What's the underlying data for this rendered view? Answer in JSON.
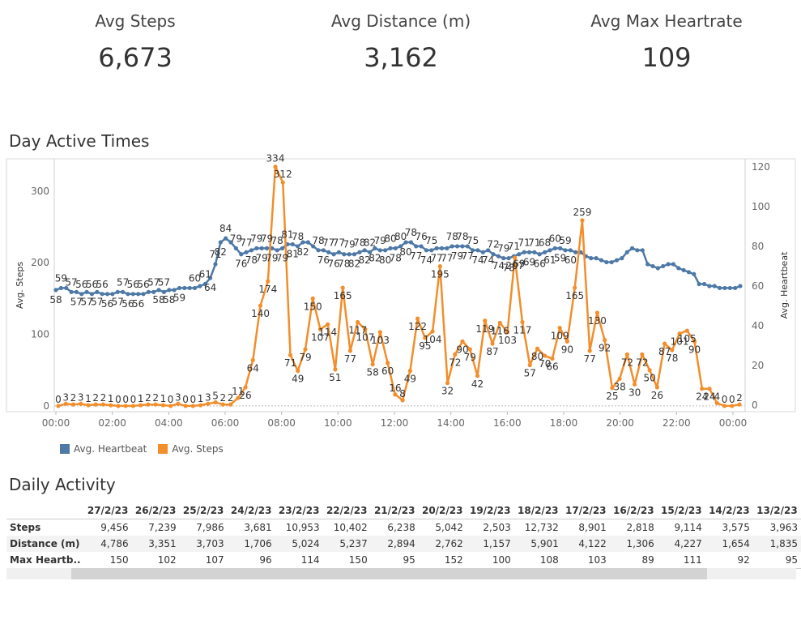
{
  "kpis": [
    {
      "label": "Avg Steps",
      "value": "6,673"
    },
    {
      "label": "Avg Distance (m)",
      "value": "3,162"
    },
    {
      "label": "Avg Max Heartrate",
      "value": "109"
    }
  ],
  "chart_title": "Day Active Times",
  "daily_title": "Daily Activity",
  "colors": {
    "heartbeat": "#4e79a7",
    "steps": "#f28e2b"
  },
  "chart_data": {
    "type": "line",
    "x_interval_minutes": 15,
    "x_start": "00:00",
    "x_ticks": [
      "00:00",
      "02:00",
      "04:00",
      "06:00",
      "08:00",
      "10:00",
      "12:00",
      "14:00",
      "16:00",
      "18:00",
      "20:00",
      "22:00",
      "00:00"
    ],
    "ylabel": "Avg. Steps",
    "y2label": "Avg. Heartbeat",
    "ylim": [
      -8,
      345
    ],
    "y2lim": [
      -3.2,
      124
    ],
    "y_ticks": [
      0,
      100,
      200,
      300
    ],
    "y2_ticks": [
      0,
      20,
      40,
      60,
      80,
      100,
      120
    ],
    "legend": [
      "Avg. Heartbeat",
      "Avg. Steps"
    ],
    "series": [
      {
        "name": "Avg. Heartbeat",
        "axis": "right",
        "values": [
          58,
          59,
          59,
          57,
          57,
          56,
          57,
          56,
          57,
          56,
          56,
          56,
          57,
          57,
          56,
          56,
          56,
          56,
          57,
          57,
          58,
          57,
          58,
          58,
          59,
          59,
          59,
          59,
          60,
          61,
          64,
          71,
          82,
          84,
          82,
          79,
          76,
          77,
          78,
          79,
          79,
          79,
          79,
          78,
          79,
          81,
          81,
          80,
          82,
          82,
          80,
          78,
          78,
          77,
          76,
          77,
          76,
          76,
          76,
          77,
          78,
          77,
          79,
          78,
          78,
          79,
          79,
          80,
          82,
          82,
          80,
          80,
          78,
          78,
          79,
          79,
          79,
          80,
          80,
          80,
          80,
          78,
          78,
          77,
          78,
          76,
          75,
          74,
          74,
          75,
          76,
          77,
          77,
          77,
          76,
          77,
          78,
          79,
          79,
          78,
          78,
          77,
          77,
          75,
          74,
          74,
          73,
          72,
          72,
          73,
          74,
          77,
          79,
          78,
          78,
          71,
          70,
          69,
          70,
          71,
          71,
          69,
          68,
          67,
          66,
          61,
          61,
          60,
          60,
          59,
          59,
          59,
          59,
          60
        ],
        "labels": {
          "0": "58",
          "3": "57",
          "4": "57",
          "5": "56",
          "6": "57",
          "7": "56",
          "8": "57",
          "9": "56",
          "10": "56",
          "12": "57",
          "13": "57",
          "14": "56",
          "15": "56",
          "16": "56",
          "17": "56",
          "19": "57",
          "20": "58",
          "21": "57",
          "22": "58",
          "24": "59",
          "27": "60",
          "29": "61",
          "30": "64",
          "31": "71",
          "32": "82",
          "33": "84",
          "35": "79",
          "36": "76",
          "37": "77",
          "38": "78",
          "39": "79",
          "40": "79",
          "41": "79",
          "42": "79",
          "43": "78",
          "44": "79",
          "45": "81",
          "46": "81",
          "47": "78",
          "48": "82",
          "51": "78",
          "52": "76",
          "53": "77",
          "54": "76",
          "55": "77",
          "56": "78",
          "57": "79",
          "58": "82",
          "59": "78",
          "60": "82",
          "61": "82",
          "62": "82",
          "63": "79",
          "64": "80",
          "65": "80",
          "66": "78",
          "67": "80",
          "68": "80",
          "69": "78",
          "70": "77",
          "71": "76",
          "72": "74",
          "73": "75",
          "74": "77",
          "76": "77",
          "77": "78",
          "78": "79",
          "79": "78",
          "80": "77",
          "81": "75",
          "82": "74",
          "84": "74",
          "85": "72",
          "86": "74",
          "87": "79",
          "88": "78",
          "89": "71",
          "90": "69",
          "91": "71",
          "92": "69",
          "93": "71",
          "94": "66",
          "95": "68",
          "96": "61",
          "97": "60",
          "98": "59",
          "99": "59",
          "100": "60",
          "1": "59"
        }
      },
      {
        "name": "Avg. Steps",
        "axis": "left",
        "values": [
          0,
          3,
          2,
          3,
          1,
          2,
          2,
          1,
          0,
          0,
          0,
          1,
          2,
          2,
          1,
          0,
          3,
          0,
          0,
          1,
          3,
          5,
          2,
          2,
          11,
          26,
          64,
          140,
          174,
          334,
          312,
          71,
          49,
          79,
          150,
          107,
          114,
          51,
          165,
          77,
          117,
          107,
          58,
          103,
          60,
          16,
          8,
          49,
          122,
          95,
          104,
          195,
          32,
          72,
          90,
          79,
          42,
          119,
          87,
          116,
          103,
          207,
          117,
          57,
          80,
          70,
          66,
          109,
          90,
          165,
          259,
          77,
          130,
          92,
          25,
          38,
          72,
          30,
          72,
          50,
          26,
          87,
          78,
          101,
          105,
          90,
          24,
          24,
          4,
          0,
          0,
          2
        ],
        "labels": {
          "0": "0",
          "1": "3",
          "2": "2",
          "3": "3",
          "4": "1",
          "5": "2",
          "6": "2",
          "7": "1",
          "8": "0",
          "9": "0",
          "10": "0",
          "11": "1",
          "12": "2",
          "13": "2",
          "14": "1",
          "15": "0",
          "16": "3",
          "17": "0",
          "18": "0",
          "19": "1",
          "20": "3",
          "21": "5",
          "22": "2",
          "23": "2",
          "24": "11",
          "25": "26",
          "26": "64",
          "27": "140",
          "28": "174",
          "29": "334",
          "30": "312",
          "31": "71",
          "32": "49",
          "33": "79",
          "34": "150",
          "35": "107",
          "36": "114",
          "37": "51",
          "38": "165",
          "39": "77",
          "40": "117",
          "41": "107",
          "42": "58",
          "43": "103",
          "44": "60",
          "45": "16",
          "46": "8",
          "47": "49",
          "48": "122",
          "49": "95",
          "50": "104",
          "51": "195",
          "52": "32",
          "53": "72",
          "54": "90",
          "55": "79",
          "56": "42",
          "57": "119",
          "58": "87",
          "59": "116",
          "60": "103",
          "61": "207",
          "62": "117",
          "63": "57",
          "64": "80",
          "65": "70",
          "66": "66",
          "67": "109",
          "68": "90",
          "69": "165",
          "70": "259",
          "71": "77",
          "72": "130",
          "73": "92",
          "74": "25",
          "75": "38",
          "76": "72",
          "77": "30",
          "78": "72",
          "79": "50",
          "80": "26",
          "81": "87",
          "82": "78",
          "83": "101",
          "84": "105",
          "85": "90",
          "86": "24",
          "87": "24",
          "88": "4",
          "89": "0",
          "90": "0",
          "91": "2"
        }
      }
    ]
  },
  "table": {
    "columns": [
      "27/2/23",
      "26/2/23",
      "25/2/23",
      "24/2/23",
      "23/2/23",
      "22/2/23",
      "21/2/23",
      "20/2/23",
      "19/2/23",
      "18/2/23",
      "17/2/23",
      "16/2/23",
      "15/2/23",
      "14/2/23",
      "13/2/23"
    ],
    "rows": [
      {
        "label": "Steps",
        "values": [
          "9,456",
          "7,239",
          "7,986",
          "3,681",
          "10,953",
          "10,402",
          "6,238",
          "5,042",
          "2,503",
          "12,732",
          "8,901",
          "2,818",
          "9,114",
          "3,575",
          "3,963"
        ]
      },
      {
        "label": "Distance (m)",
        "values": [
          "4,786",
          "3,351",
          "3,703",
          "1,706",
          "5,024",
          "5,237",
          "2,894",
          "2,762",
          "1,157",
          "5,901",
          "4,122",
          "1,306",
          "4,227",
          "1,654",
          "1,835"
        ]
      },
      {
        "label": "Max Heartb..",
        "values": [
          "150",
          "102",
          "107",
          "96",
          "114",
          "150",
          "95",
          "152",
          "100",
          "108",
          "103",
          "89",
          "111",
          "92",
          "95"
        ]
      }
    ]
  }
}
